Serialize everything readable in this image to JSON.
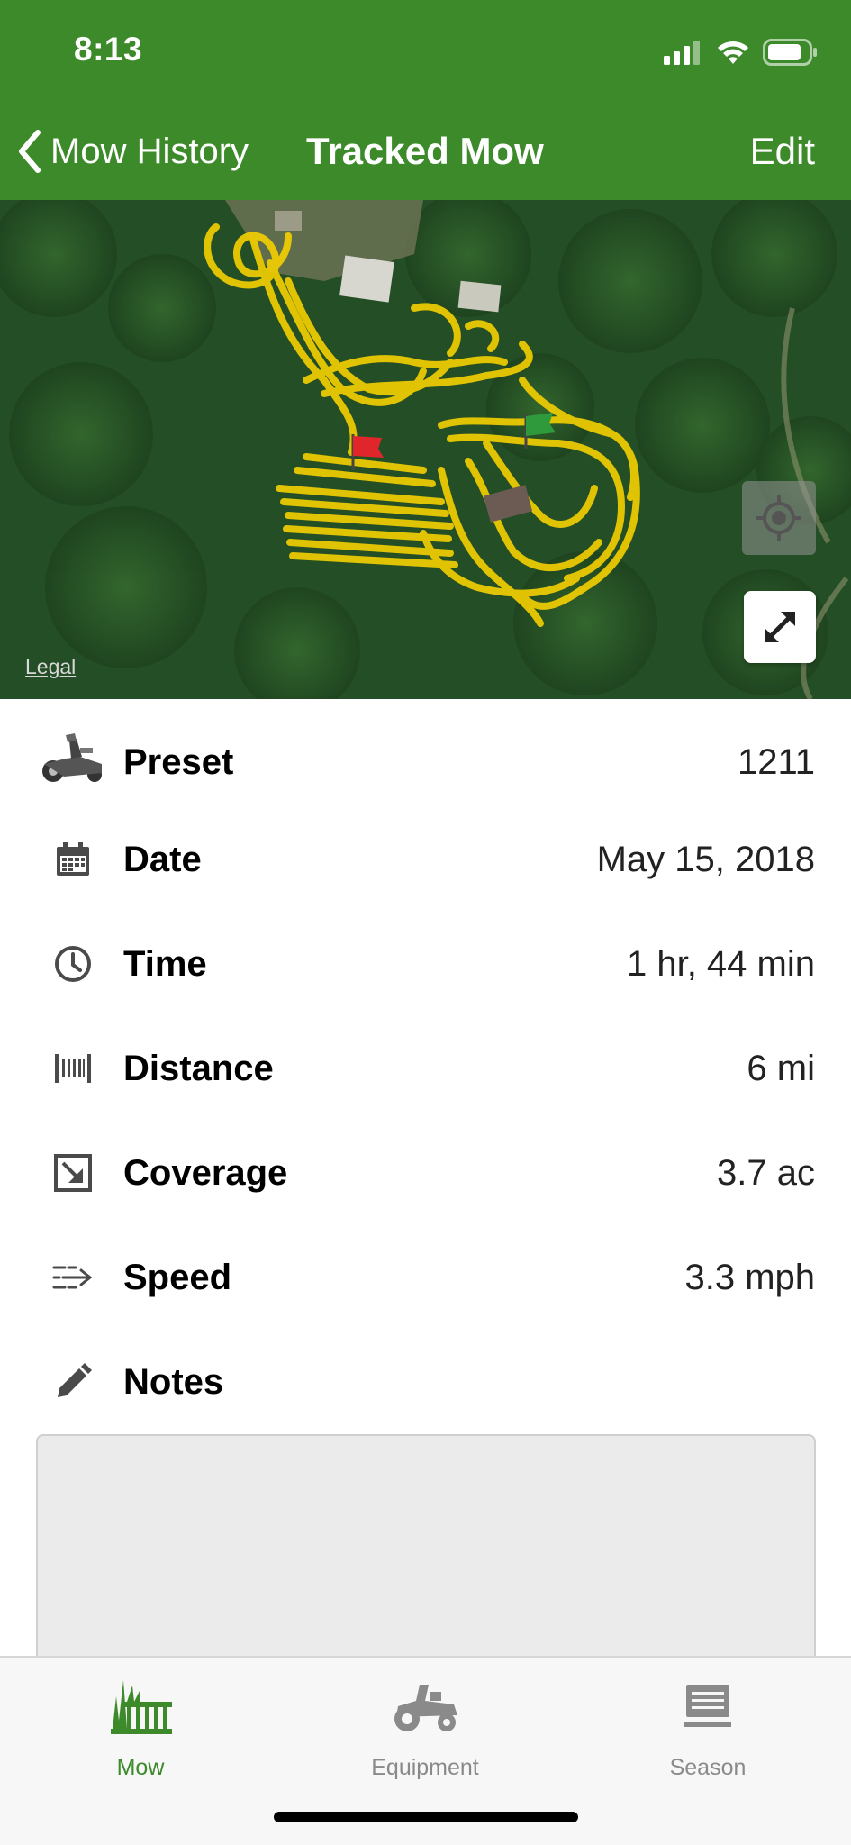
{
  "status_bar": {
    "time": "8:13"
  },
  "nav": {
    "back_label": "Mow History",
    "title": "Tracked Mow",
    "edit_label": "Edit"
  },
  "map": {
    "legal_label": "Legal",
    "track_color": "#f5d000",
    "start_flag_color": "#e0262a",
    "end_flag_color": "#2f9a3b"
  },
  "details": {
    "preset": {
      "label": "Preset",
      "value": "1211",
      "icon": "mower-icon"
    },
    "date": {
      "label": "Date",
      "value": "May 15, 2018",
      "icon": "calendar-icon"
    },
    "time": {
      "label": "Time",
      "value": "1 hr, 44 min",
      "icon": "clock-icon"
    },
    "distance": {
      "label": "Distance",
      "value": "6 mi",
      "icon": "distance-icon"
    },
    "coverage": {
      "label": "Coverage",
      "value": "3.7 ac",
      "icon": "coverage-icon"
    },
    "speed": {
      "label": "Speed",
      "value": "3.3 mph",
      "icon": "speed-icon"
    },
    "notes": {
      "label": "Notes",
      "value": "",
      "icon": "pencil-icon"
    }
  },
  "tabs": [
    {
      "label": "Mow",
      "icon": "mow-icon",
      "active": true
    },
    {
      "label": "Equipment",
      "icon": "tractor-icon",
      "active": false
    },
    {
      "label": "Season",
      "icon": "season-icon",
      "active": false
    }
  ],
  "colors": {
    "brand_green": "#3d8a2a",
    "tab_inactive": "#8a8a8a"
  }
}
